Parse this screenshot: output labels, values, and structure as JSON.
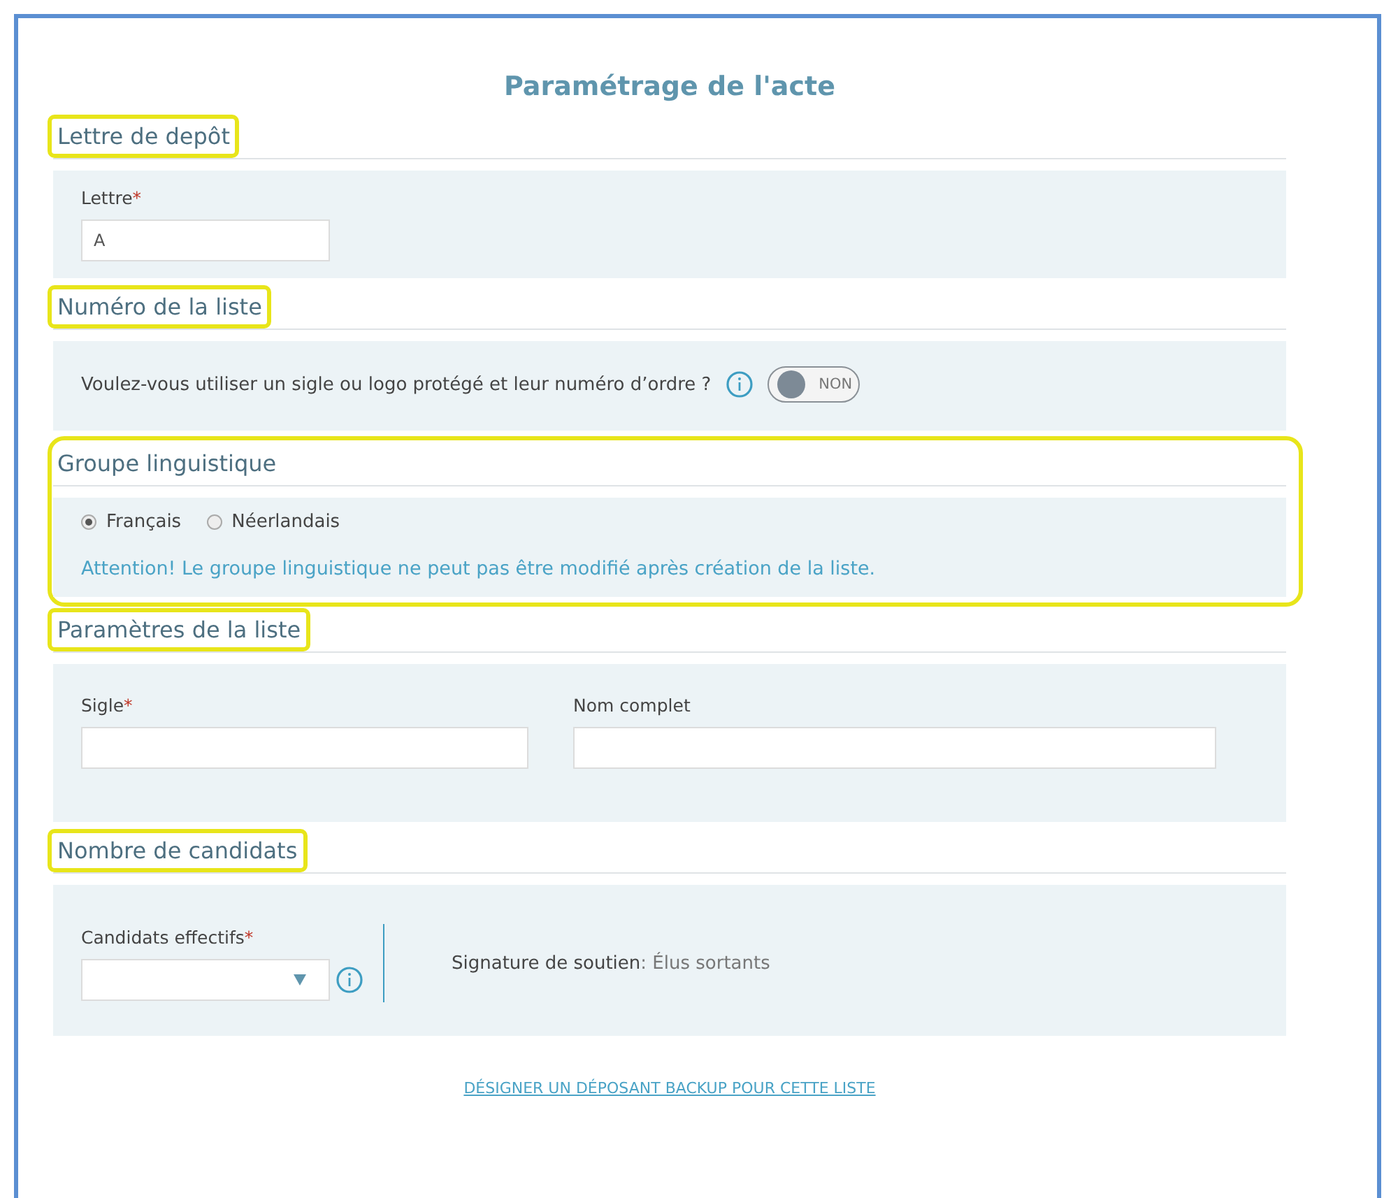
{
  "title": "Paramétrage de l'acte",
  "sections": [
    {
      "kind": "letter",
      "heading": "Lettre de depôt",
      "highlighted": true,
      "field": {
        "label": "Lettre",
        "required_mark": "*",
        "value": "A"
      }
    },
    {
      "kind": "toggle",
      "heading": "Numéro de la liste",
      "highlighted": true,
      "question": "Voulez-vous utiliser un sigle ou logo protégé et leur numéro d’ordre ?",
      "toggle": {
        "on": false,
        "text": "NON"
      }
    },
    {
      "kind": "radio",
      "heading": "Groupe linguistique",
      "highlighted": true,
      "options": [
        {
          "label": "Français",
          "selected": true
        },
        {
          "label": "Néerlandais",
          "selected": false
        }
      ],
      "warning": "Attention! Le groupe linguistique ne peut pas être modifié après création de la liste."
    },
    {
      "kind": "fields",
      "heading": "Paramètres de la liste",
      "highlighted": true,
      "fields": [
        {
          "label": "Sigle",
          "required_mark": "*"
        },
        {
          "label": "Nom complet"
        }
      ]
    },
    {
      "kind": "candidates",
      "heading": "Nombre de candidats",
      "highlighted": true,
      "select": {
        "label": "Candidats effectifs",
        "required_mark": "*"
      },
      "signature": {
        "label": "Signature de soutien",
        "value": ": Élus sortants"
      }
    }
  ],
  "link": "DÉSIGNER UN DÉPOSANT BACKUP POUR CETTE LISTE"
}
